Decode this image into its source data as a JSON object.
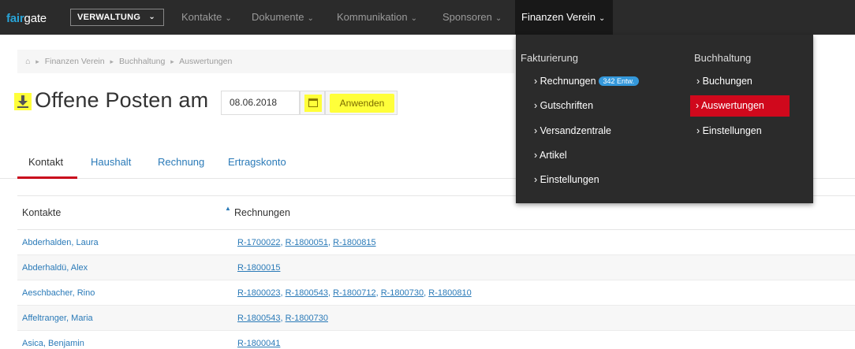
{
  "nav": {
    "logo_accent": "fair",
    "logo_rest": "gate",
    "verwaltung": "VERWALTUNG",
    "caret": "⌄",
    "items": [
      {
        "label": "Kontakte"
      },
      {
        "label": "Dokumente"
      },
      {
        "label": "Kommunikation"
      },
      {
        "label": "Sponsoren"
      },
      {
        "label": "Finanzen Verein"
      }
    ]
  },
  "dropdown": {
    "fakturierung": {
      "heading": "Fakturierung",
      "items": [
        "› Rechnungen",
        "› Gutschriften",
        "› Versandzentrale",
        "› Artikel",
        "› Einstellungen"
      ],
      "badge": "342 Entw."
    },
    "buchhaltung": {
      "heading": "Buchhaltung",
      "items": [
        "› Buchungen",
        "› Auswertungen",
        "› Einstellungen"
      ]
    },
    "selected_color": "#d0081c"
  },
  "breadcrumb": {
    "icon": "home-icon",
    "items": [
      "Finanzen Verein",
      "Buchhaltung",
      "Auswertungen"
    ]
  },
  "page": {
    "title": "Offene Posten am",
    "date_value": "08.06.2018",
    "apply_label": "Anwenden",
    "highlight_color": "#ffff3a"
  },
  "tabs": [
    {
      "label": "Kontakt",
      "active": true
    },
    {
      "label": "Haushalt",
      "active": false
    },
    {
      "label": "Rechnung",
      "active": false
    },
    {
      "label": "Ertragskonto",
      "active": false
    }
  ],
  "table": {
    "headers": {
      "contacts": "Kontakte",
      "invoices": "Rechnungen"
    },
    "rows": [
      {
        "name": "Abderhalden, Laura",
        "invoices": [
          "R-1700022",
          "R-1800051",
          "R-1800815"
        ]
      },
      {
        "name": "Abderhaldü, Alex",
        "invoices": [
          "R-1800015"
        ]
      },
      {
        "name": "Aeschbacher, Rino",
        "invoices": [
          "R-1800023",
          "R-1800543",
          "R-1800712",
          "R-1800730",
          "R-1800810"
        ]
      },
      {
        "name": "Affeltranger, Maria",
        "invoices": [
          "R-1800543",
          "R-1800730"
        ]
      },
      {
        "name": "Asica, Benjamin",
        "invoices": [
          "R-1800041"
        ]
      }
    ]
  },
  "colors": {
    "link": "#2a7ab8",
    "topbar": "#2b2b2b",
    "active_tab": "#c9081c"
  }
}
